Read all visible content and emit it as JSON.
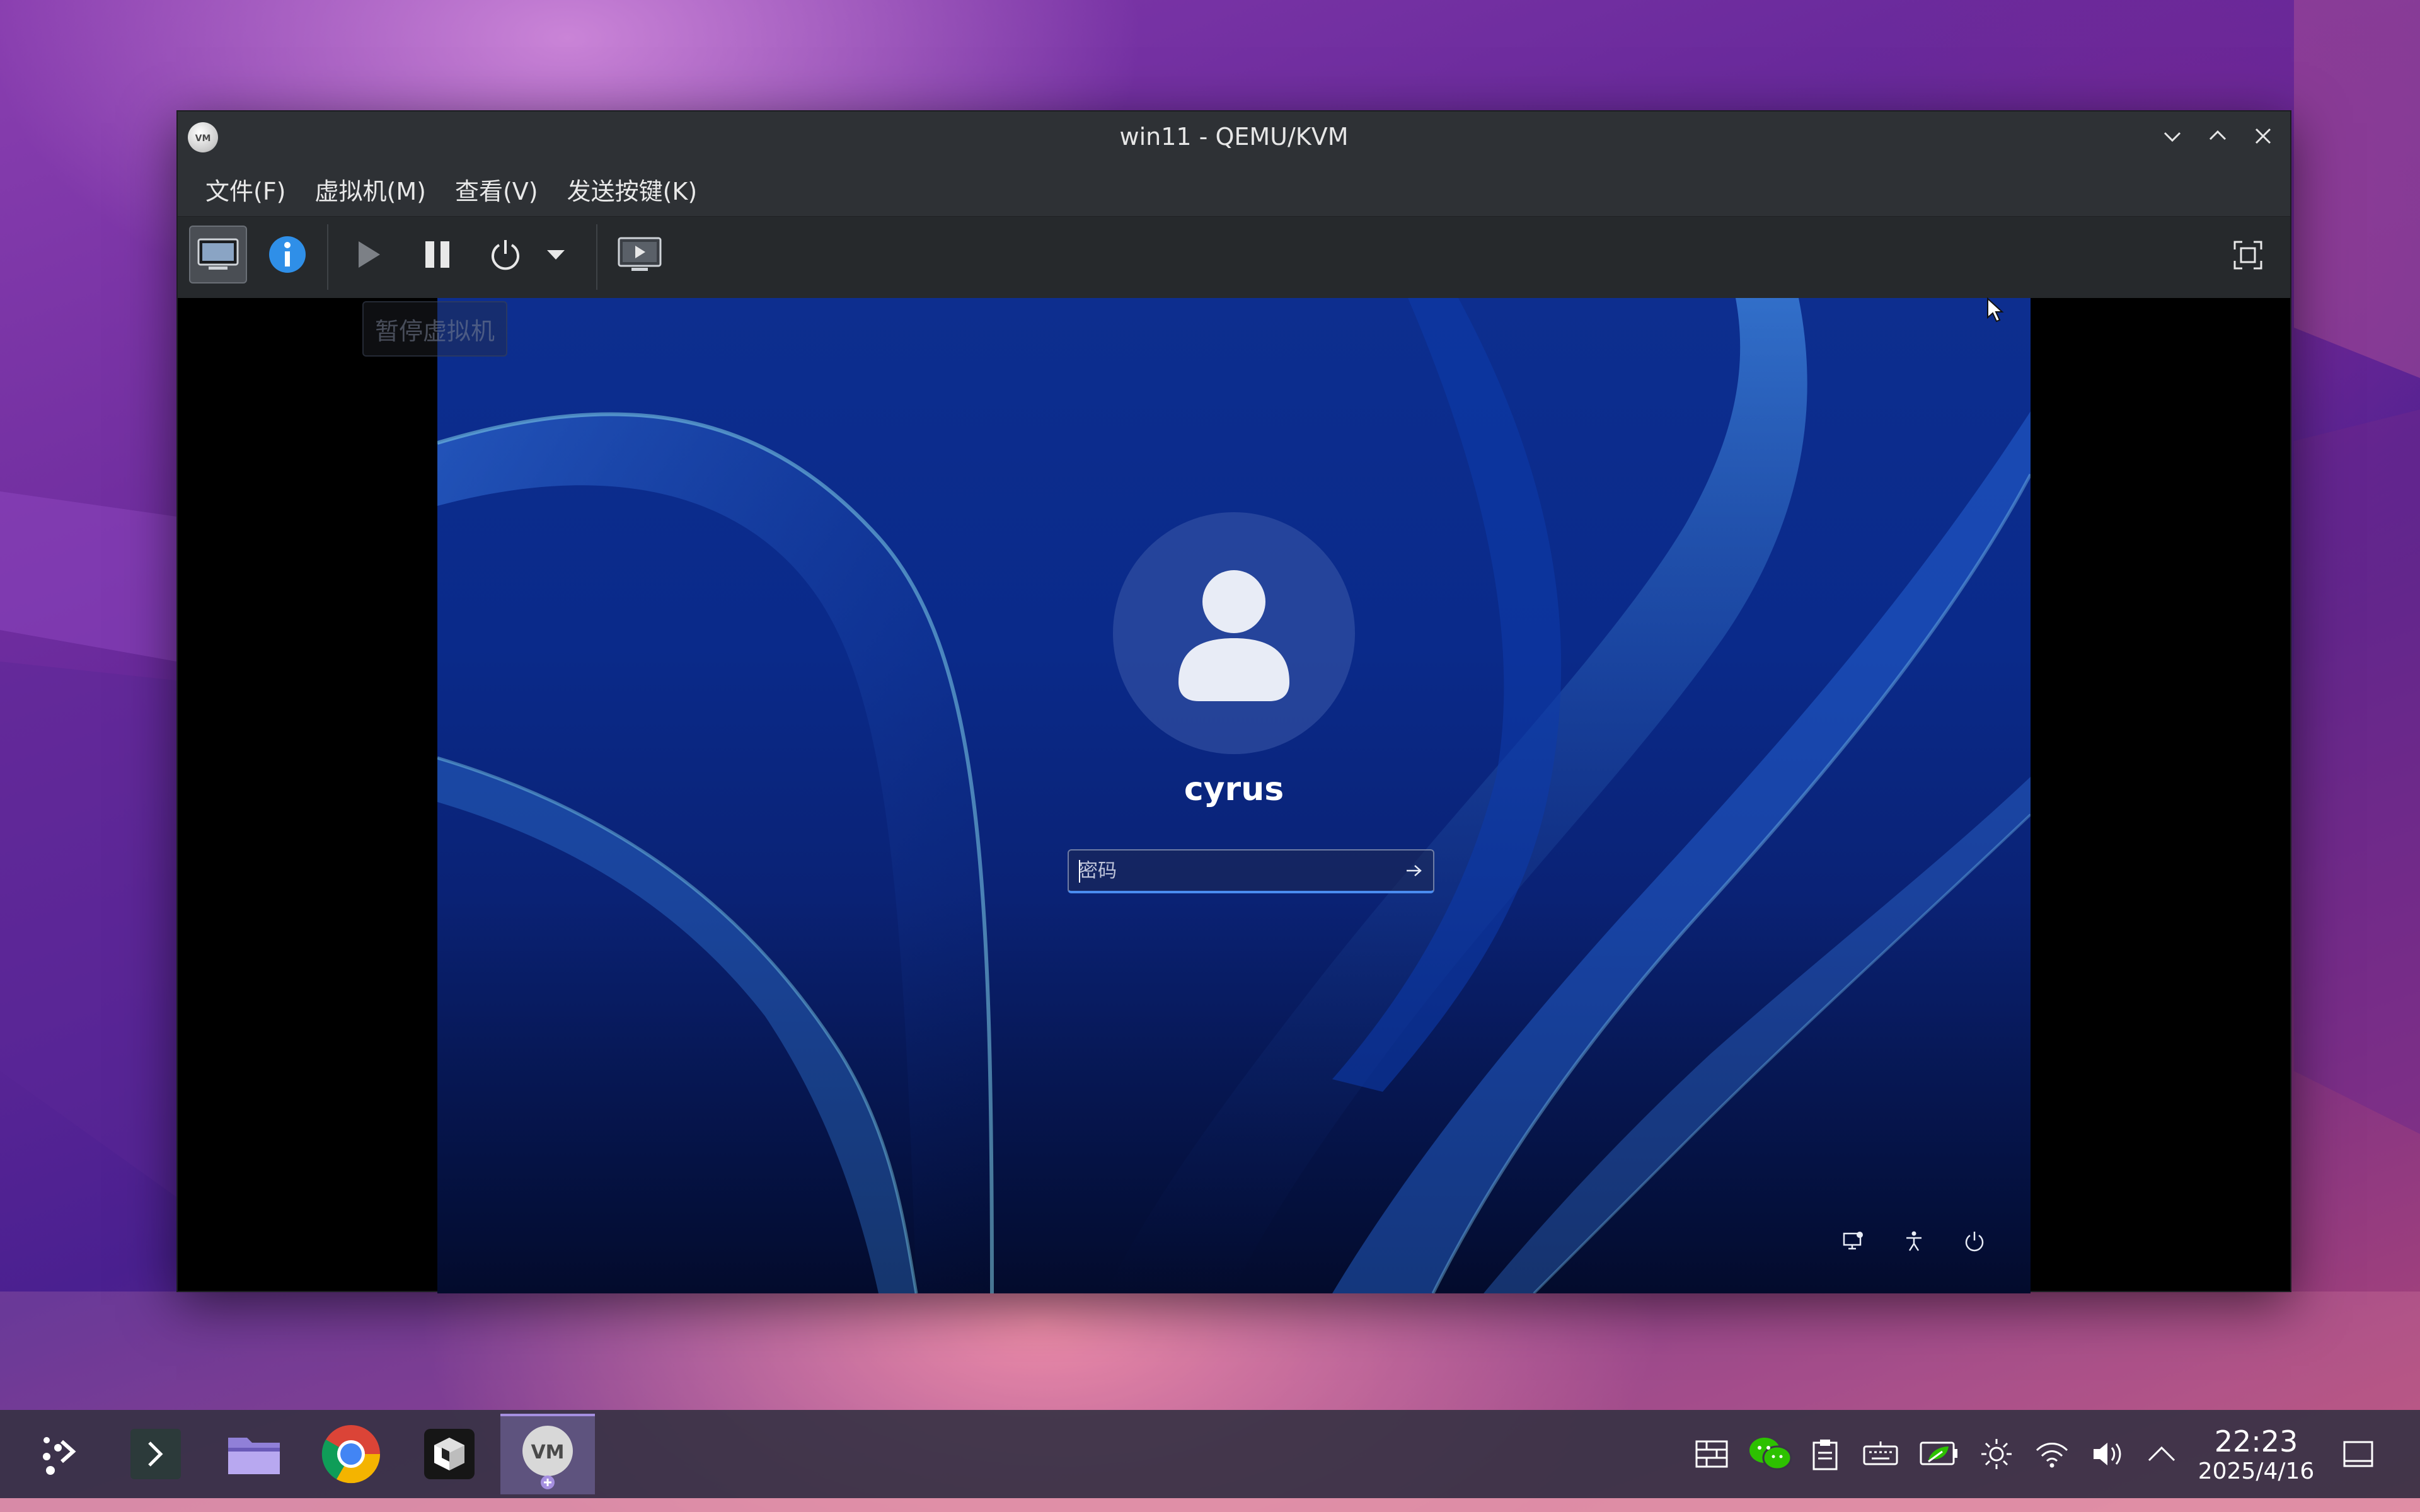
{
  "window": {
    "title": "win11 - QEMU/KVM"
  },
  "menu": {
    "file": "文件(F)",
    "vm": "虚拟机(M)",
    "view": "查看(V)",
    "sendkey": "发送按键(K)"
  },
  "toolbar": {
    "tooltip": "暂停虚拟机",
    "icons": [
      "monitor-icon",
      "info-icon",
      "play-icon",
      "pause-icon",
      "power-icon",
      "dropdown-arrow-icon",
      "screenshot-icon",
      "fullscreen-icon"
    ]
  },
  "login": {
    "username": "cyrus",
    "password_placeholder": "密码"
  },
  "taskbar": {
    "time": "22:23",
    "date": "2025/4/16"
  },
  "colors": {
    "accent": "#4a8cf0",
    "info": "#2f8fe8"
  }
}
